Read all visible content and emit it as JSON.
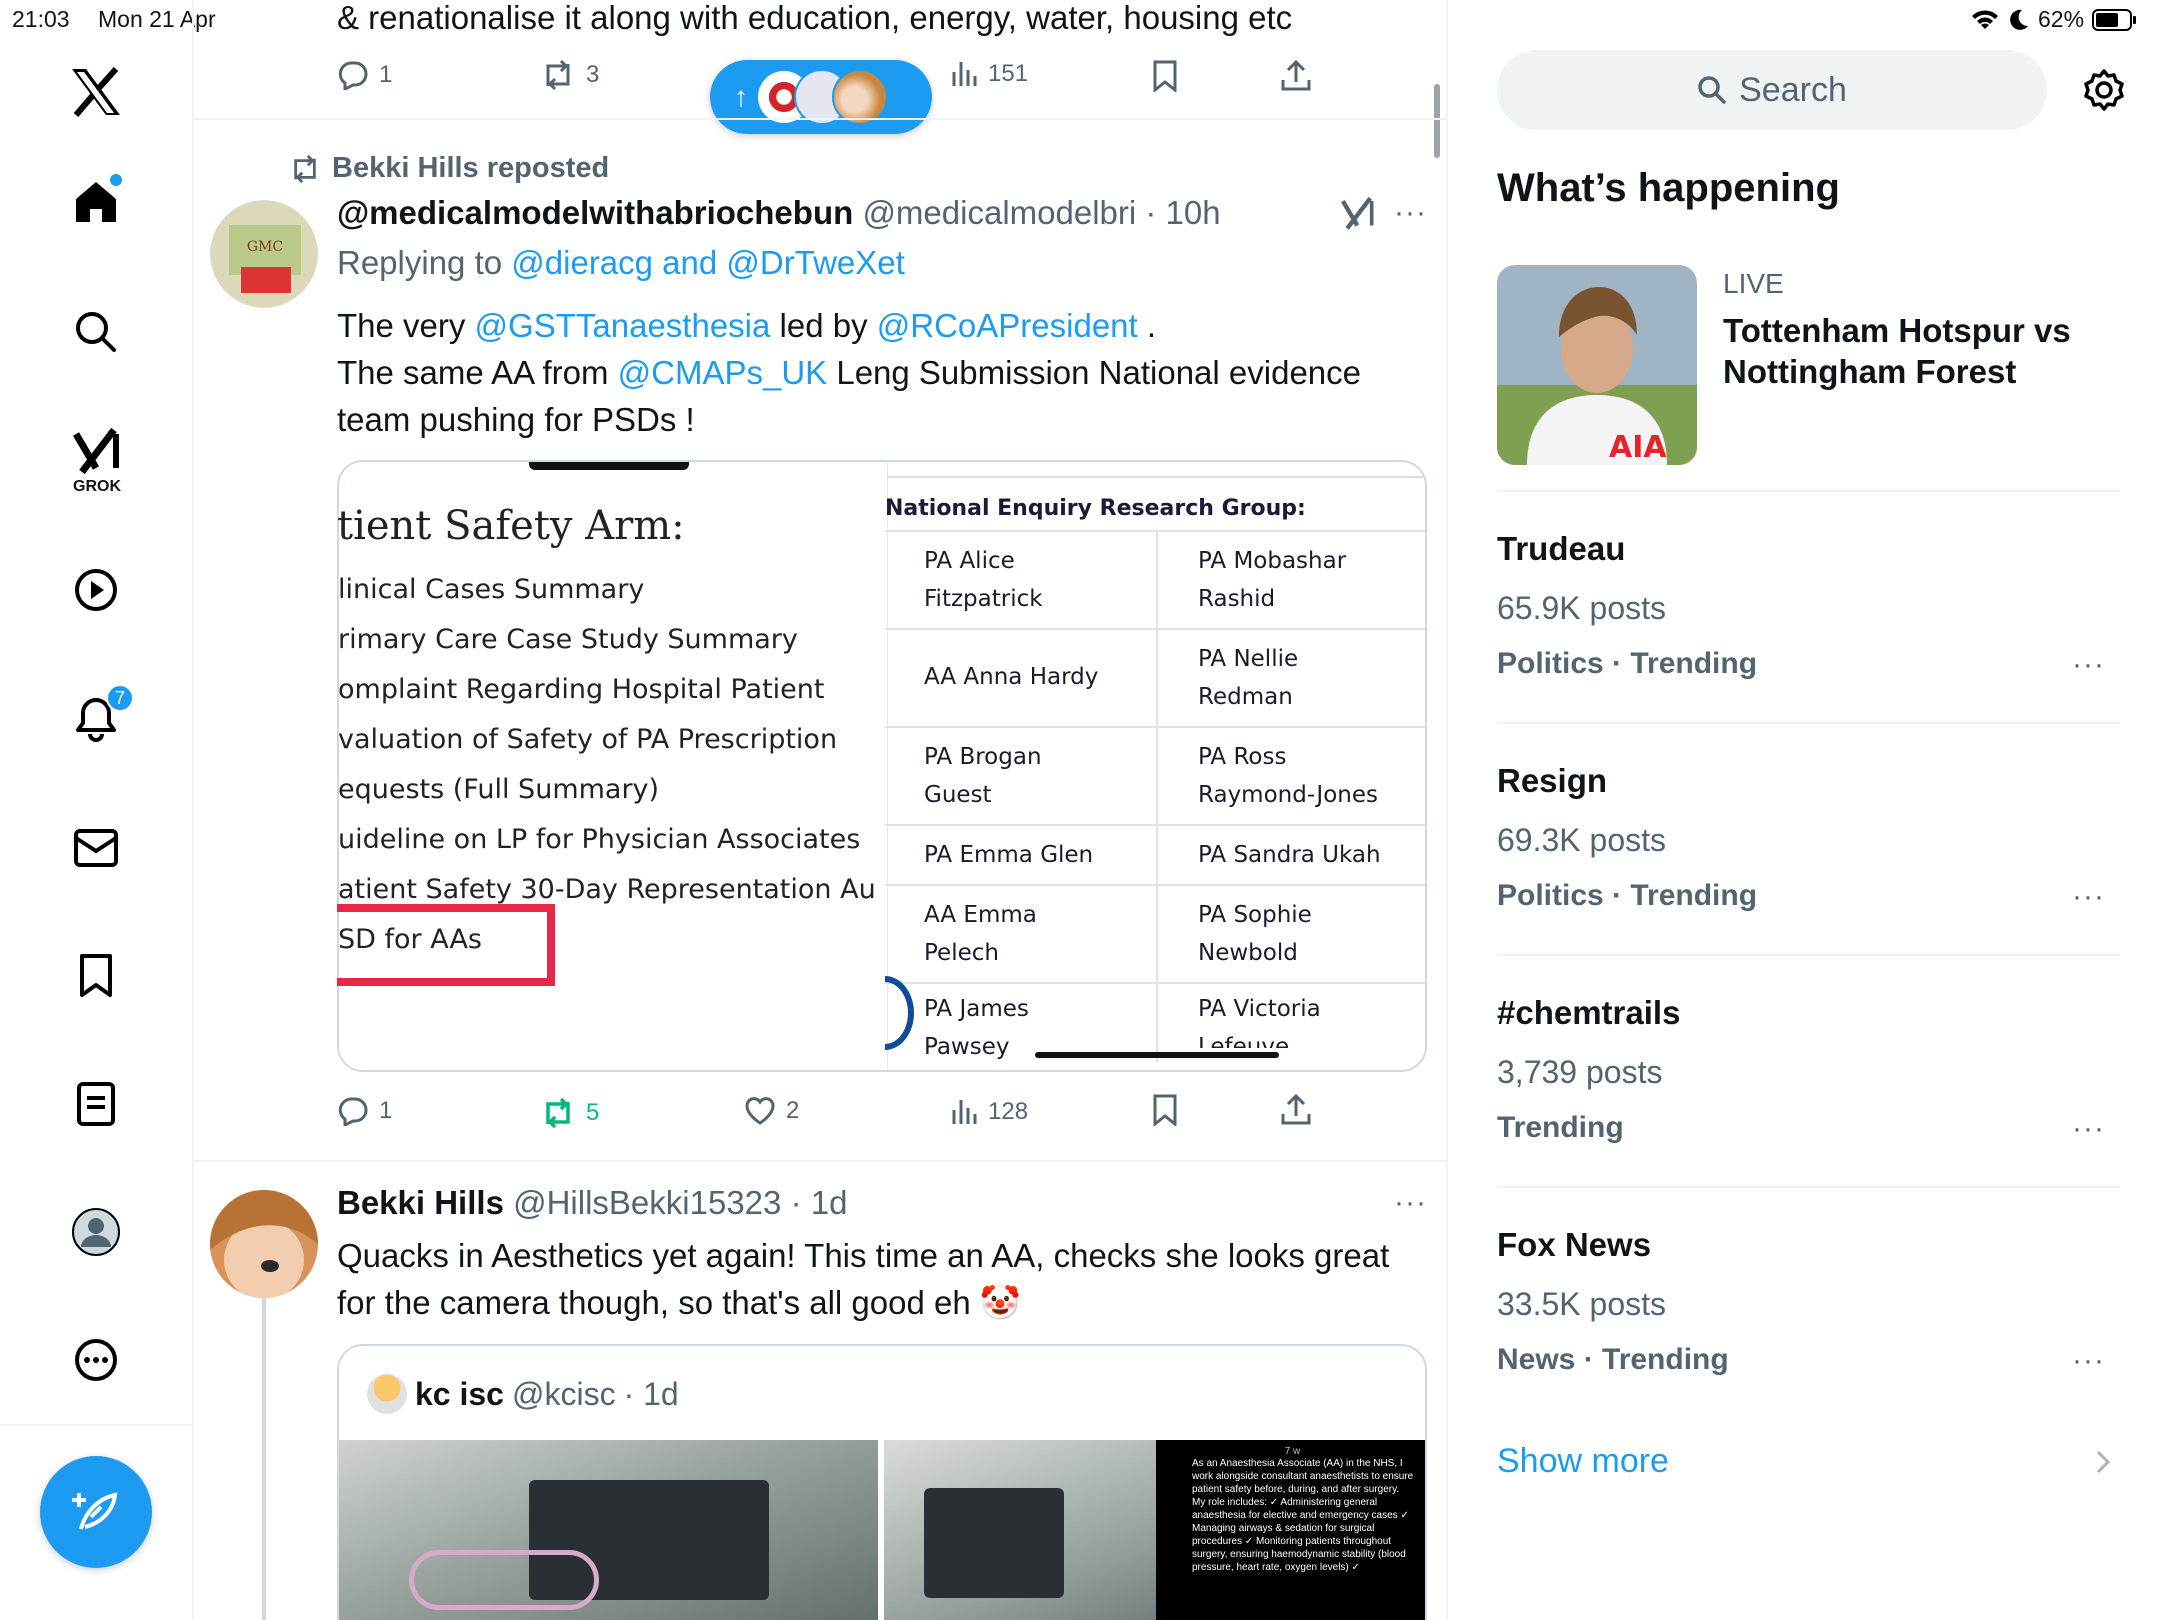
{
  "status_bar": {
    "time": "21:03",
    "date": "Mon 21 Apr",
    "battery": "62%"
  },
  "sidebar": {
    "grok_label": "GROK",
    "notification_count": "7"
  },
  "top_tweet": {
    "text": "& renationalise it along with education, energy, water, housing etc",
    "replies": "1",
    "reposts": "3",
    "views": "151"
  },
  "new_posts_pill": {
    "arrow": "↑"
  },
  "tweet1": {
    "repost_label": "Bekki Hills reposted",
    "name": "@medicalmodelwithabriochebun",
    "handle": "@medicalmodelbri",
    "time": "· 10h",
    "replying_prefix": "Replying to",
    "replying_to": "@dieracg and @DrTweXet",
    "line1_a": "The very ",
    "line1_mention1": "@GSTTanaesthesia",
    "line1_b": " led by ",
    "line1_mention2": "@RCoAPresident",
    "line1_c": " .",
    "line2_a": "The same AA from ",
    "line2_mention": "@CMAPs_UK",
    "line2_b": " Leng Submission National evidence",
    "line3": "team pushing for PSDs !",
    "image": {
      "doc_title": "tient Safety Arm:",
      "doc_lines": [
        "linical Cases Summary",
        "rimary Care Case Study Summary",
        "omplaint Regarding Hospital Patient",
        "valuation of Safety of PA Prescription",
        "equests (Full Summary)",
        "uideline on LP for Physician Associates",
        "atient Safety 30-Day Representation Au",
        "SD for AAs"
      ],
      "list_title": "National Enquiry Research Group:",
      "list_rows": [
        [
          "PA Alice\nFitzpatrick",
          "PA Mobashar\nRashid"
        ],
        [
          "AA Anna Hardy",
          "PA Nellie\nRedman"
        ],
        [
          "PA Brogan\nGuest",
          "PA Ross\nRaymond-Jones"
        ],
        [
          "PA Emma Glen",
          "PA Sandra Ukah"
        ],
        [
          "AA Emma\nPelech",
          "PA Sophie\nNewbold"
        ],
        [
          "PA James\nPawsey",
          "PA Victoria\nLefeuve"
        ]
      ]
    },
    "replies": "1",
    "reposts": "5",
    "likes": "2",
    "views": "128"
  },
  "tweet2": {
    "name": "Bekki Hills",
    "handle": "@HillsBekki15323",
    "time": "· 1d",
    "text": "Quacks in Aesthetics yet again! This time an AA, checks she looks great for the camera though, so that's all good eh 🤡",
    "quote": {
      "name": "kc isc",
      "handle": "@kcisc",
      "time": "· 1d",
      "overlay_time": "7 w",
      "overlay_text": "As an Anaesthesia Associate (AA) in the NHS, I work alongside consultant anaesthetists to ensure patient safety before, during, and after surgery. My role includes: ✓ Administering general anaesthesia for elective and emergency cases ✓ Managing airways & sedation for surgical procedures ✓ Monitoring patients throughout surgery, ensuring haemodynamic stability (blood pressure, heart rate, oxygen levels) ✓"
    }
  },
  "right": {
    "search_placeholder": "Search",
    "whats_happening": "What’s happening",
    "live_label": "LIVE",
    "live_title": "Tottenham Hotspur vs Nottingham Forest",
    "trends": [
      {
        "title": "Trudeau",
        "count": "65.9K posts",
        "context": "Politics · Trending"
      },
      {
        "title": "Resign",
        "count": "69.3K posts",
        "context": "Politics · Trending"
      },
      {
        "title": "#chemtrails",
        "count": "3,739 posts",
        "context": "Trending"
      },
      {
        "title": "Fox News",
        "count": "33.5K posts",
        "context": "News · Trending"
      }
    ],
    "show_more": "Show more",
    "more_dots": "···"
  },
  "colors": {
    "accent": "#1d9bf0",
    "repost_green": "#00ba7c",
    "text": "#0f1419",
    "muted": "#536471"
  }
}
